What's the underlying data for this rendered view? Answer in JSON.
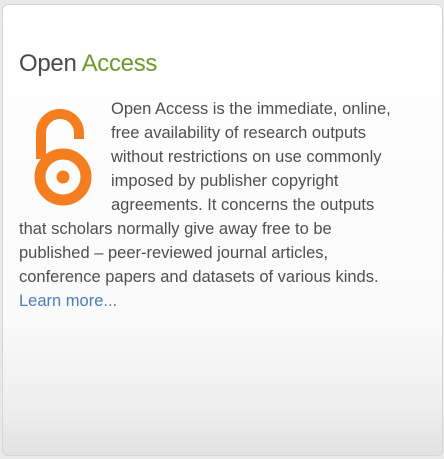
{
  "widget": {
    "title_part1": "Open",
    "title_part2": "Access",
    "body_text": "Open Access is the immediate, online, free availability of research outputs without restrictions on use commonly imposed by publisher copyright agreements. It concerns the outputs that scholars normally give away free to be published – peer-reviewed journal articles, conference papers and datasets of various kinds.",
    "learn_more": "Learn more...",
    "logo_icon": "open-access-lock-icon",
    "colors": {
      "title_text": "#4a4a4a",
      "title_accent": "#6d9a2a",
      "logo_orange": "#f47e1f",
      "link": "#4a7fb5",
      "body_text": "#4f4f4f"
    }
  }
}
